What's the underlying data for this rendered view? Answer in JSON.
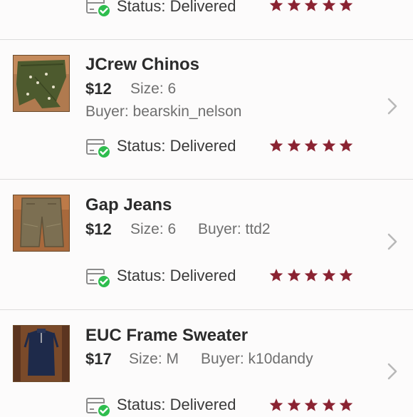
{
  "items": [
    {
      "title": "",
      "price": "",
      "size": "",
      "buyer": "",
      "status": "Status: Delivered",
      "rating": 5
    },
    {
      "title": "JCrew Chinos",
      "price": "$12",
      "size": "Size: 6",
      "buyer": "Buyer: bearskin_nelson",
      "status": "Status: Delivered",
      "rating": 5
    },
    {
      "title": "Gap Jeans",
      "price": "$12",
      "size": "Size: 6",
      "buyer": "Buyer: ttd2",
      "status": "Status: Delivered",
      "rating": 5
    },
    {
      "title": "EUC Frame Sweater",
      "price": "$17",
      "size": "Size: M",
      "buyer": "Buyer: k10dandy",
      "status": "Status: Delivered",
      "rating": 5
    }
  ],
  "colors": {
    "star": "#8a2332",
    "delivered_check": "#2ebd4e",
    "divider": "#dcdcdc"
  },
  "icons": {
    "status": "delivered-box-check-icon",
    "rating": "star-icon",
    "nav": "chevron-right-icon"
  }
}
